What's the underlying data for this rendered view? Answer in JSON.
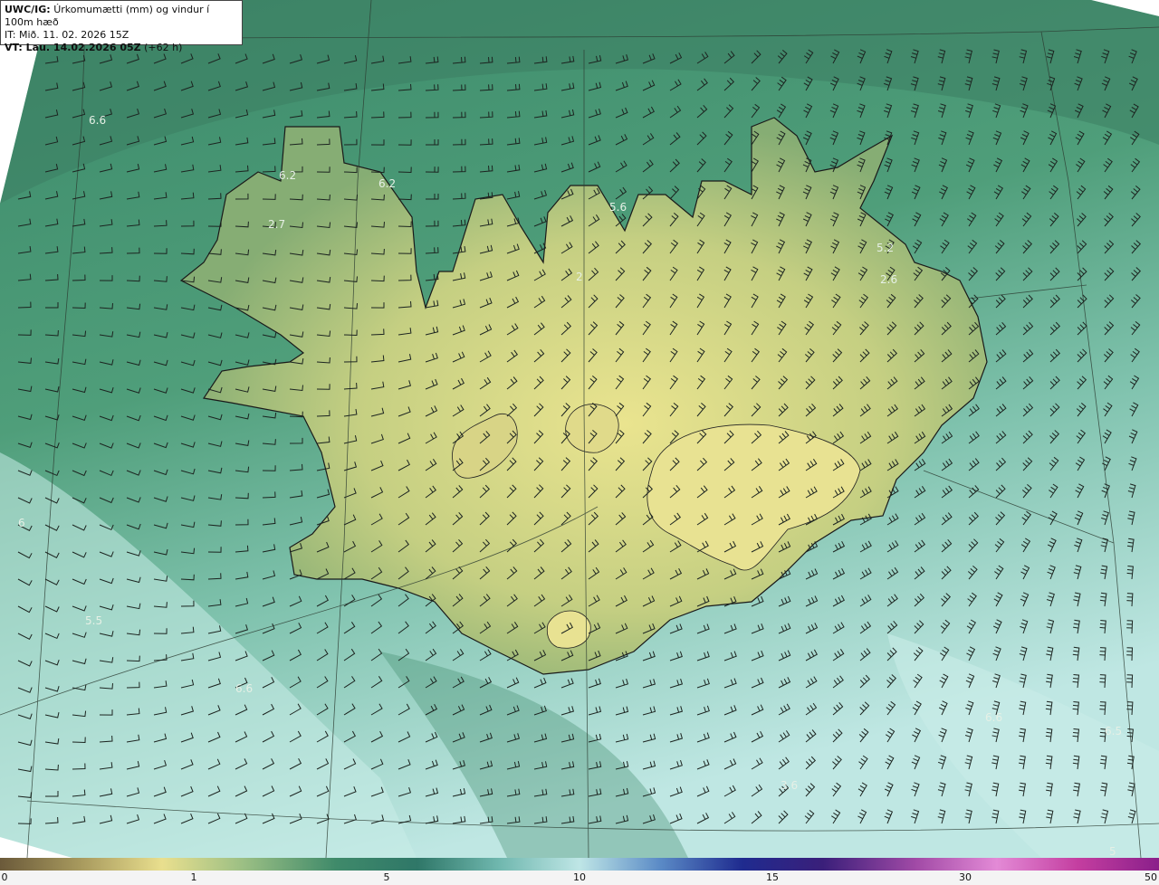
{
  "header": {
    "product": "UWC/IG:",
    "title": "Úrkomumætti (mm) og vindur í 100m hæð",
    "init_time": "IT: Mið. 11. 02. 2026 15Z",
    "valid_prefix": "VT: Lau. 14.02.2026 05Z",
    "valid_suffix": " (+62 h)"
  },
  "value_labels": [
    "6.6",
    "6.2",
    "6.2",
    "2.7",
    "5.6",
    "5.2",
    "2.6",
    "2",
    "6",
    "5.5",
    "6.6",
    "6.6",
    "3.6",
    "6.5",
    "5"
  ],
  "colorbar": {
    "ticks": [
      "0",
      "1",
      "5",
      "10",
      "15",
      "30",
      "50"
    ],
    "colors": [
      "#6b5a3a",
      "#a89a5e",
      "#e9df8e",
      "#9bbf84",
      "#3f8a6a",
      "#2f7768",
      "#6fb7ae",
      "#bfe6e6",
      "#5a8ac6",
      "#1f2b8f",
      "#3a1f7a",
      "#a14aa6",
      "#e38ad6",
      "#c43ea0",
      "#8a1f8a"
    ]
  },
  "colors": {
    "land_light": "#e3df8a",
    "land_mid": "#a8c07a",
    "sea_dark": "#2f7a62",
    "sea_mid": "#4f9a74",
    "sea_light": "#9fd3c6",
    "sea_pale": "#d8f2f0",
    "coast": "#1a1a1a",
    "grid": "#2b3a30",
    "barb": "#1c2420"
  }
}
